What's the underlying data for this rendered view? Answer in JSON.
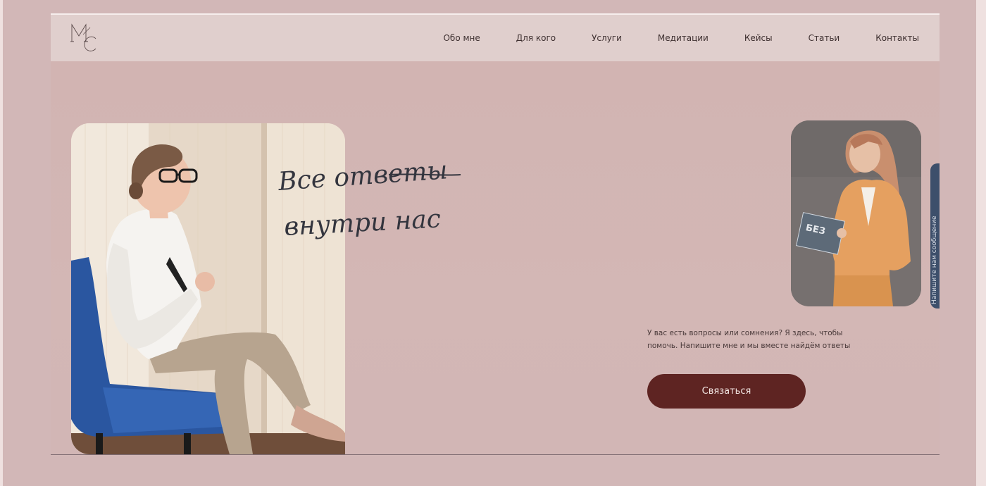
{
  "logo": {
    "letters": "MC"
  },
  "nav": {
    "items": [
      {
        "label": "Обо мне"
      },
      {
        "label": "Для кого"
      },
      {
        "label": "Услуги"
      },
      {
        "label": "Медитации"
      },
      {
        "label": "Кейсы"
      },
      {
        "label": "Статьи"
      },
      {
        "label": "Контакты"
      }
    ]
  },
  "hero": {
    "handwriting": {
      "line1": "Все ответы",
      "line2": "внутри нас"
    },
    "text": "У вас есть вопросы или сомнения? Я здесь, чтобы помочь. Напишите мне и мы вместе найдём ответы",
    "cta_label": "Связаться"
  },
  "side_tab": {
    "label": "Напишите нам сообщение"
  },
  "colors": {
    "background": "#d2b7b7",
    "header": "#e0cfcd",
    "cta": "#5e2422",
    "side_tab": "#3d4f6b"
  }
}
